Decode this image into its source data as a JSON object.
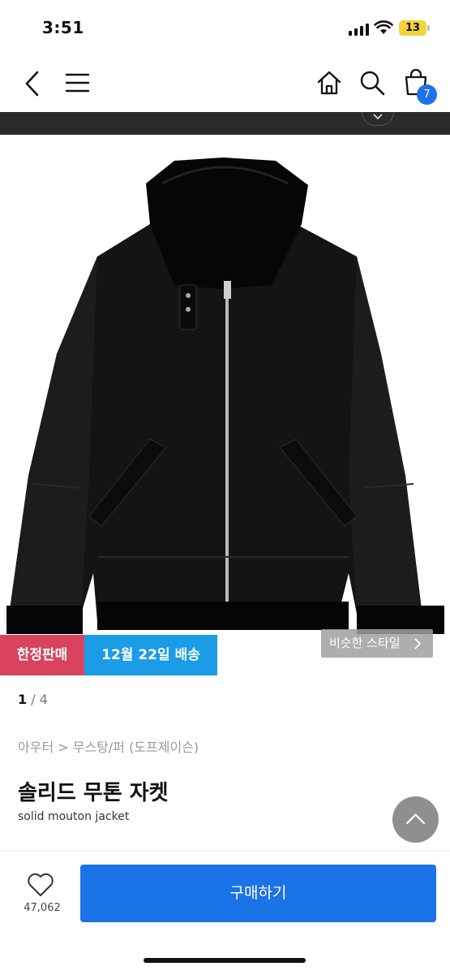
{
  "status_bar": {
    "time": "3:51",
    "battery": "13"
  },
  "nav": {
    "cart_count": "7"
  },
  "product": {
    "tag_limited": "한정판매",
    "tag_delivery": "12월 22일 배송",
    "similar_style": "비슷한 스타일",
    "pager_current": "1",
    "pager_total": "4",
    "pager_separator": " / ",
    "breadcrumb": "아우터 > 무스탕/퍼 (도프제이슨)",
    "title": "솔리드 무톤 자켓",
    "subtitle": "solid mouton jacket"
  },
  "bottom_bar": {
    "like_count": "47,062",
    "buy_label": "구매하기"
  },
  "colors": {
    "brand_blue": "#1b73e8",
    "tag_limited_bg": "#d8445e",
    "tag_delivery_bg": "#1a9ce6"
  }
}
